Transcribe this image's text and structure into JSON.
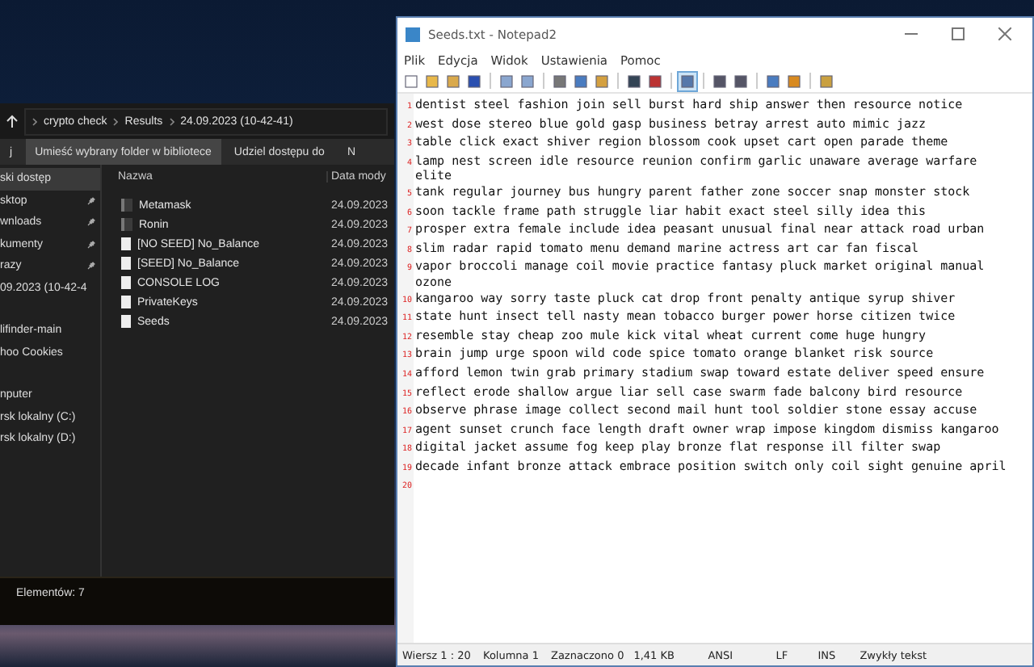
{
  "explorer": {
    "address": [
      "crypto check",
      "Results",
      "24.09.2023 (10-42-41)"
    ],
    "toolbar": [
      {
        "label": "j",
        "selected": false
      },
      {
        "label": "Umieść wybrany folder w bibliotece",
        "selected": true
      },
      {
        "label": "Udziel dostępu do",
        "selected": false
      },
      {
        "label": "N",
        "selected": false
      }
    ],
    "nav": [
      {
        "label": "ski dostęp",
        "pinned": false,
        "selected": true,
        "gap": false
      },
      {
        "label": "sktop",
        "pinned": true,
        "selected": false,
        "gap": false
      },
      {
        "label": "wnloads",
        "pinned": true,
        "selected": false,
        "gap": false
      },
      {
        "label": "kumenty",
        "pinned": true,
        "selected": false,
        "gap": false
      },
      {
        "label": "razy",
        "pinned": true,
        "selected": false,
        "gap": false
      },
      {
        "label": "09.2023 (10-42-4",
        "pinned": false,
        "selected": false,
        "gap": false
      },
      {
        "label": "lifinder-main",
        "pinned": false,
        "selected": false,
        "gap": true
      },
      {
        "label": "hoo Cookies",
        "pinned": false,
        "selected": false,
        "gap": false
      },
      {
        "label": "nputer",
        "pinned": false,
        "selected": false,
        "gap": true
      },
      {
        "label": "rsk lokalny (C:)",
        "pinned": false,
        "selected": false,
        "gap": false
      },
      {
        "label": "rsk lokalny (D:)",
        "pinned": false,
        "selected": false,
        "gap": false
      }
    ],
    "columns": [
      "Nazwa",
      "Data mody"
    ],
    "files": [
      {
        "name": "Metamask",
        "date": "24.09.2023",
        "kind": "folder"
      },
      {
        "name": "Ronin",
        "date": "24.09.2023",
        "kind": "folder"
      },
      {
        "name": "[NO SEED] No_Balance",
        "date": "24.09.2023",
        "kind": "file"
      },
      {
        "name": "[SEED] No_Balance",
        "date": "24.09.2023",
        "kind": "file"
      },
      {
        "name": "CONSOLE LOG",
        "date": "24.09.2023",
        "kind": "file"
      },
      {
        "name": "PrivateKeys",
        "date": "24.09.2023",
        "kind": "file"
      },
      {
        "name": "Seeds",
        "date": "24.09.2023",
        "kind": "file"
      }
    ],
    "status": "Elementów: 7"
  },
  "notepad": {
    "title": "Seeds.txt - Notepad2",
    "menu": [
      "Plik",
      "Edycja",
      "Widok",
      "Ustawienia",
      "Pomoc"
    ],
    "tools": [
      {
        "kind": "button",
        "selected": false
      },
      {
        "kind": "button",
        "selected": false
      },
      {
        "kind": "button",
        "selected": false
      },
      {
        "kind": "button",
        "selected": false
      },
      {
        "kind": "separator"
      },
      {
        "kind": "button",
        "selected": false
      },
      {
        "kind": "button",
        "selected": false
      },
      {
        "kind": "separator"
      },
      {
        "kind": "button",
        "selected": false
      },
      {
        "kind": "button",
        "selected": false
      },
      {
        "kind": "button",
        "selected": false
      },
      {
        "kind": "separator"
      },
      {
        "kind": "button",
        "selected": false
      },
      {
        "kind": "button",
        "selected": false
      },
      {
        "kind": "separator"
      },
      {
        "kind": "button",
        "selected": true
      },
      {
        "kind": "separator"
      },
      {
        "kind": "button",
        "selected": false
      },
      {
        "kind": "button",
        "selected": false
      },
      {
        "kind": "separator"
      },
      {
        "kind": "button",
        "selected": false
      },
      {
        "kind": "button",
        "selected": false
      },
      {
        "kind": "separator"
      },
      {
        "kind": "button",
        "selected": false
      }
    ],
    "lines": [
      {
        "number": "1",
        "text": "dentist steel fashion join sell burst hard ship answer then resource notice"
      },
      {
        "number": "2",
        "text": "west dose stereo blue gold gasp business betray arrest auto mimic jazz"
      },
      {
        "number": "3",
        "text": "table click exact shiver region blossom cook upset cart open parade theme"
      },
      {
        "number": "4",
        "text": "lamp nest screen idle resource reunion confirm garlic unaware average warfare elite"
      },
      {
        "number": "5",
        "text": "tank regular journey bus hungry parent father zone soccer snap monster stock"
      },
      {
        "number": "6",
        "text": "soon tackle frame path struggle liar habit exact steel silly idea this"
      },
      {
        "number": "7",
        "text": "prosper extra female include idea peasant unusual final near attack road urban"
      },
      {
        "number": "8",
        "text": "slim radar rapid tomato menu demand marine actress art car fan fiscal"
      },
      {
        "number": "9",
        "text": "vapor broccoli manage coil movie practice fantasy pluck market original manual ozone"
      },
      {
        "number": "10",
        "text": "kangaroo way sorry taste pluck cat drop front penalty antique syrup shiver"
      },
      {
        "number": "11",
        "text": "state hunt insect tell nasty mean tobacco burger power horse citizen twice"
      },
      {
        "number": "12",
        "text": "resemble stay cheap zoo mule kick vital wheat current come huge hungry"
      },
      {
        "number": "13",
        "text": "brain jump urge spoon wild code spice tomato orange blanket risk source"
      },
      {
        "number": "14",
        "text": "afford lemon twin grab primary stadium swap toward estate deliver speed ensure"
      },
      {
        "number": "15",
        "text": "reflect erode shallow argue liar sell case swarm fade balcony bird resource"
      },
      {
        "number": "16",
        "text": "observe phrase image collect second mail hunt tool soldier stone essay accuse"
      },
      {
        "number": "17",
        "text": "agent sunset crunch face length draft owner wrap impose kingdom dismiss kangaroo"
      },
      {
        "number": "18",
        "text": "digital jacket assume fog keep play bronze flat response ill filter swap"
      },
      {
        "number": "19",
        "text": "decade infant bronze attack embrace position switch only coil sight genuine april"
      },
      {
        "number": "20"
      }
    ],
    "status": [
      "Wiersz 1 : 20",
      "Kolumna 1",
      "Zaznaczono 0",
      "1,41 KB",
      "ANSI",
      "LF",
      "INS",
      "Zwykły tekst"
    ]
  }
}
